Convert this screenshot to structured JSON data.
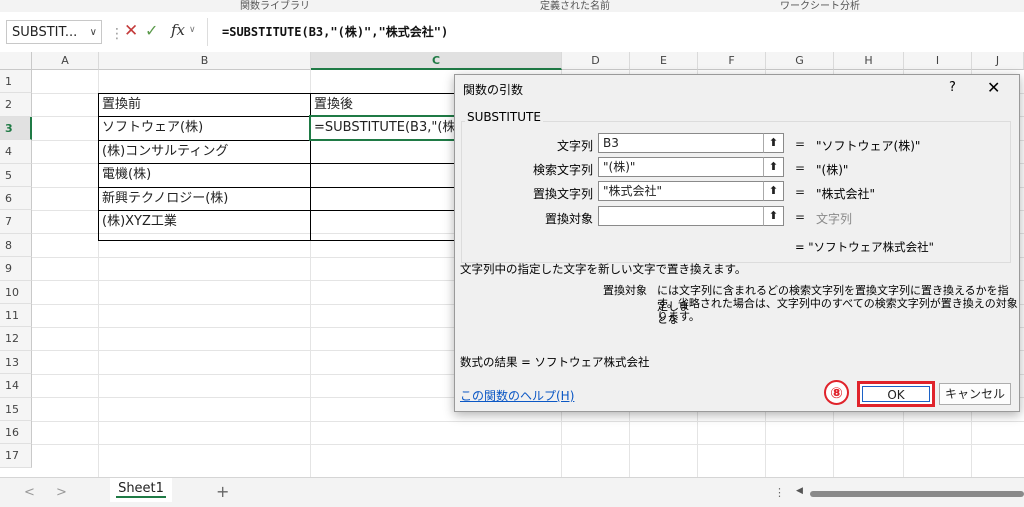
{
  "ribbon": {
    "groups": [
      "関数ライブラリ",
      "定義された名前",
      "ワークシート分析"
    ]
  },
  "formula_bar": {
    "name_box": "SUBSTIT...",
    "formula": "=SUBSTITUTE(B3,\"(株)\",\"株式会社\")"
  },
  "sheet": {
    "columns": [
      "A",
      "B",
      "C",
      "D",
      "E",
      "F",
      "G",
      "H",
      "I",
      "J"
    ],
    "rows": [
      "1",
      "2",
      "3",
      "4",
      "5",
      "6",
      "7",
      "8",
      "9",
      "10",
      "11",
      "12",
      "13",
      "14",
      "15",
      "16",
      "17"
    ],
    "selected_column": "C",
    "selected_row": "3",
    "cells": {
      "B2": "置換前",
      "C2": "置換後",
      "B3": "ソフトウェア(株)",
      "C3": "=SUBSTITUTE(B3,\"(株",
      "B4": "(株)コンサルティング",
      "B5": "電機(株)",
      "B6": "新興テクノロジー(株)",
      "B7": "(株)XYZ工業"
    }
  },
  "status_bar": {
    "sheet_tab": "Sheet1",
    "add_sheet": "+",
    "more": "⋮"
  },
  "dialog": {
    "title": "関数の引数",
    "help_symbol": "?",
    "close_symbol": "✕",
    "function_name": "SUBSTITUTE",
    "arguments": [
      {
        "label": "文字列",
        "value": "B3",
        "result": "\"ソフトウェア(株)\"",
        "dim": false
      },
      {
        "label": "検索文字列",
        "value": "\"(株)\"",
        "result": "\"(株)\"",
        "dim": false
      },
      {
        "label": "置換文字列",
        "value": "\"株式会社\"",
        "result": "\"株式会社\"",
        "dim": false
      },
      {
        "label": "置換対象",
        "value": "",
        "result": "文字列",
        "dim": true
      }
    ],
    "equals": "=",
    "overall_result": "= \"ソフトウェア株式会社\"",
    "description": "文字列中の指定した文字を新しい文字で置き換えます。",
    "arg_help_name": "置換対象",
    "arg_help_line1": "には文字列に含まれるどの検索文字列を置換文字列に置き換えるかを指定しま",
    "arg_help_line2": "す。省略された場合は、文字列中のすべての検索文字列が置き換えの対象とな",
    "arg_help_line3": "ります。",
    "formula_result": "数式の結果 =  ソフトウェア株式会社",
    "help_link": "この関数のヘルプ(H)",
    "ok_label": "OK",
    "cancel_label": "キャンセル",
    "step_badge": "⑧"
  }
}
